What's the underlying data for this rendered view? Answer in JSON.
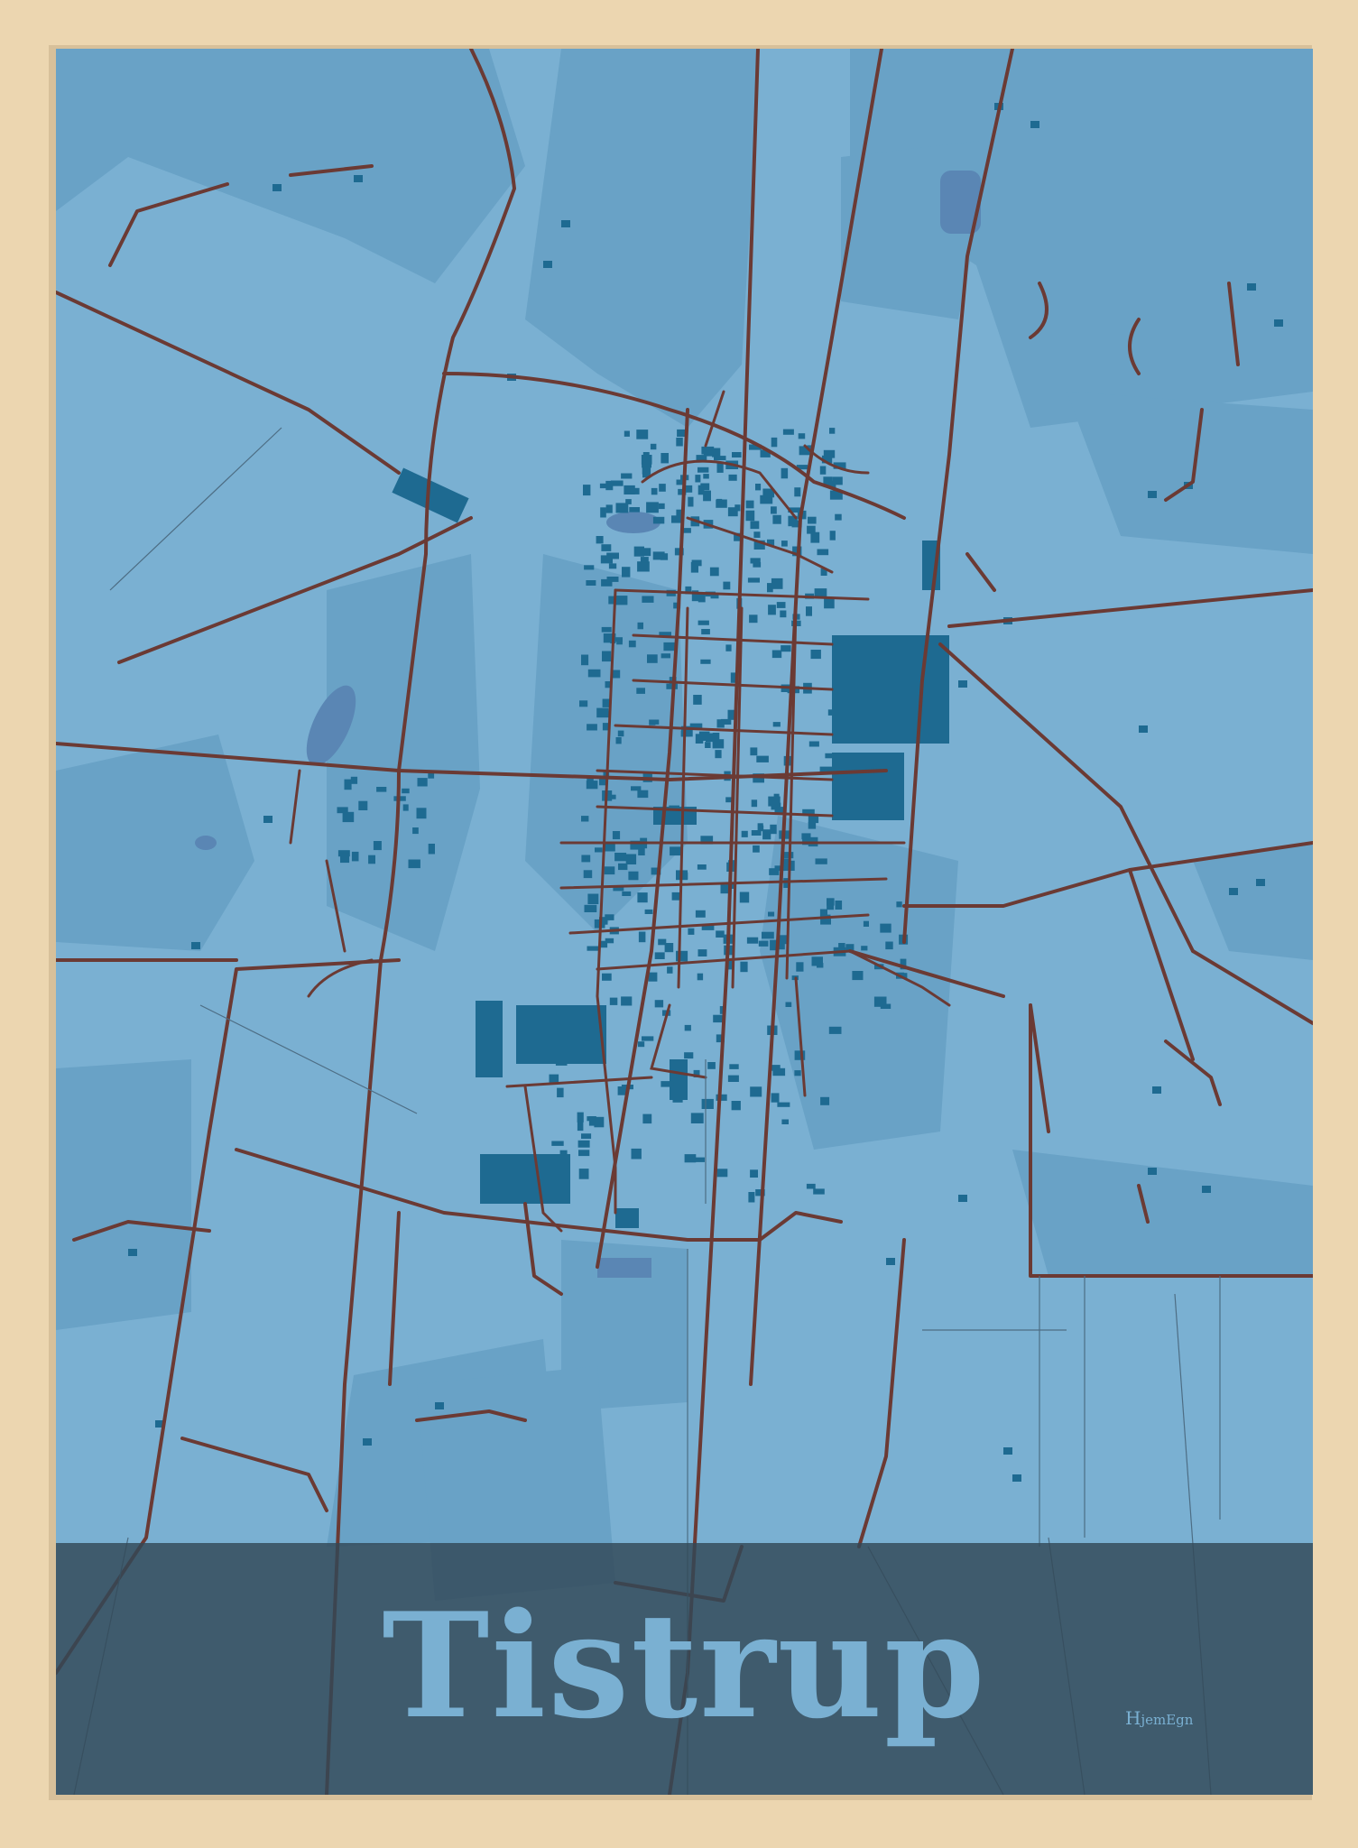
{
  "poster": {
    "title": "Tistrup",
    "brand": "HjemEgn",
    "brand_first": "H",
    "brand_rest": "jemEgn"
  },
  "colors": {
    "frame": "#ecd6b0",
    "map_base": "#7ab0d2",
    "map_dark_areas": "#69a2c6",
    "buildings": "#1e6a91",
    "roads": "#6b3a34",
    "water": "#5a86b4",
    "title_band": "#324857",
    "title_text": "#7ab0d2"
  },
  "map": {
    "place_labels_visible": false
  }
}
